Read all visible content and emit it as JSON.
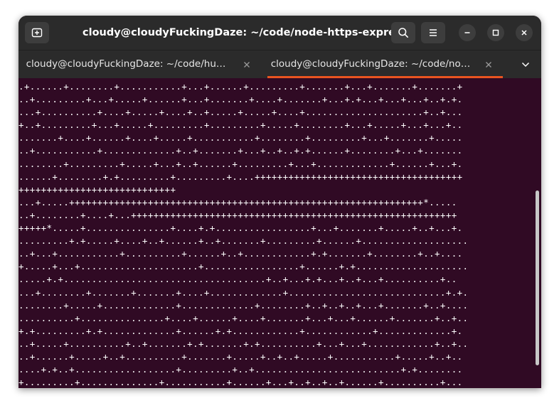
{
  "window": {
    "title": "cloudy@cloudyFuckingDaze: ~/code/node-https-express"
  },
  "titlebar": {
    "buttons": {
      "new_tab_icon": "new-tab-icon",
      "search_icon": "search-icon",
      "menu_icon": "hamburger-menu-icon",
      "minimize_icon": "minimize-icon",
      "maximize_icon": "maximize-icon",
      "close_icon": "close-icon"
    }
  },
  "tabs": [
    {
      "label": "cloudy@cloudyFuckingDaze: ~/code/hu…",
      "active": false
    },
    {
      "label": "cloudy@cloudyFuckingDaze: ~/code/no…",
      "active": true
    }
  ],
  "tab_overflow_icon": "chevron-down-icon",
  "colors": {
    "terminal_bg": "#300a24",
    "chrome_bg": "#2b2b2b",
    "active_tab_accent": "#e95420",
    "text": "#ffffff"
  },
  "terminal": {
    "lines": [
      ".+......+........+...........+...+......+.........+.......+...+.......+.......+",
      "..+.........+...+.....+......+...+.......+....+.......+...+.+...+...+...+..+.+.",
      "...+..........+....+.....+....+..+.....+.....+....+.....................+..+...",
      "+..+.........+...+.....+.........+.........+.....+........+...+.....+...+...+..",
      ".......+....+......+....+.....+...........+........+.........+...+.......+.....",
      "..+...........+.............+..+.......+...+..+..+.+......+........+...+.......",
      "........+.........+.....+...+..+......+.........+...+.............+......+...+.",
      "......+........+.+.........+.........+....+++++++++++++++++++++++++++++++++++++",
      "++++++++++++++++++++++++++++",
      "...+.....+++++++++++++++++++++++++++++++++++++++++++++++++++++++++++++++*.....",
      "..+........+....+...++++++++++++++++++++++++++++++++++++++++++++++++++++++++++",
      "+++++*.....+...............+....+.+.................+...+.......+.....+..+...+.",
      ".........+.+.....+....+..+......+..+.......+.........+......+...................",
      "..+...+...........+..........+......+..+............+.+.......+........+..+....",
      "+.....+...+.....................+.................+......+.+....................",
      ".....+.+....................................+..+...+.+...+..+...+..........+..",
      "...+........+.......+.......+....+.............+............................+.+.",
      "........+.....+.............+.............+........+..+..+..+...+.......+..+....",
      "..........+...............+....+......+....+.......+...+...+......+.......+..+..",
      "+.+.........+.+.............+......+.+............+............+.............+.",
      "..+.....+..........+..+.......+.+.......+.+..........+...+...+............+..+..",
      "..+......+.....+..+..........+.......+.....+..+..+.....+...........+.....+..+..",
      "....+.+..+..................+.........+..+..........................+.+........",
      "+.........+..............+...........+......+...+..+..+..+......+..........+..."
    ]
  }
}
